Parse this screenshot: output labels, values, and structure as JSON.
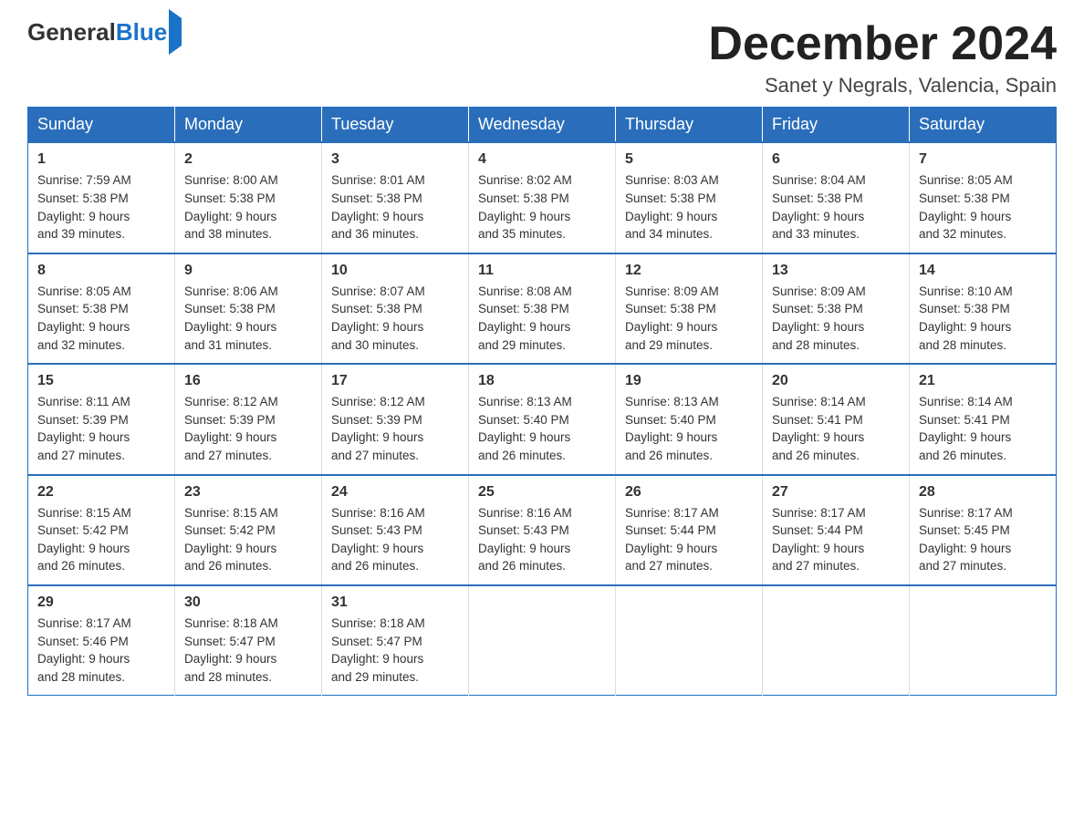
{
  "header": {
    "logo_general": "General",
    "logo_blue": "Blue",
    "month_title": "December 2024",
    "subtitle": "Sanet y Negrals, Valencia, Spain"
  },
  "weekdays": [
    "Sunday",
    "Monday",
    "Tuesday",
    "Wednesday",
    "Thursday",
    "Friday",
    "Saturday"
  ],
  "weeks": [
    [
      {
        "day": "1",
        "sunrise": "7:59 AM",
        "sunset": "5:38 PM",
        "daylight": "9 hours and 39 minutes."
      },
      {
        "day": "2",
        "sunrise": "8:00 AM",
        "sunset": "5:38 PM",
        "daylight": "9 hours and 38 minutes."
      },
      {
        "day": "3",
        "sunrise": "8:01 AM",
        "sunset": "5:38 PM",
        "daylight": "9 hours and 36 minutes."
      },
      {
        "day": "4",
        "sunrise": "8:02 AM",
        "sunset": "5:38 PM",
        "daylight": "9 hours and 35 minutes."
      },
      {
        "day": "5",
        "sunrise": "8:03 AM",
        "sunset": "5:38 PM",
        "daylight": "9 hours and 34 minutes."
      },
      {
        "day": "6",
        "sunrise": "8:04 AM",
        "sunset": "5:38 PM",
        "daylight": "9 hours and 33 minutes."
      },
      {
        "day": "7",
        "sunrise": "8:05 AM",
        "sunset": "5:38 PM",
        "daylight": "9 hours and 32 minutes."
      }
    ],
    [
      {
        "day": "8",
        "sunrise": "8:05 AM",
        "sunset": "5:38 PM",
        "daylight": "9 hours and 32 minutes."
      },
      {
        "day": "9",
        "sunrise": "8:06 AM",
        "sunset": "5:38 PM",
        "daylight": "9 hours and 31 minutes."
      },
      {
        "day": "10",
        "sunrise": "8:07 AM",
        "sunset": "5:38 PM",
        "daylight": "9 hours and 30 minutes."
      },
      {
        "day": "11",
        "sunrise": "8:08 AM",
        "sunset": "5:38 PM",
        "daylight": "9 hours and 29 minutes."
      },
      {
        "day": "12",
        "sunrise": "8:09 AM",
        "sunset": "5:38 PM",
        "daylight": "9 hours and 29 minutes."
      },
      {
        "day": "13",
        "sunrise": "8:09 AM",
        "sunset": "5:38 PM",
        "daylight": "9 hours and 28 minutes."
      },
      {
        "day": "14",
        "sunrise": "8:10 AM",
        "sunset": "5:38 PM",
        "daylight": "9 hours and 28 minutes."
      }
    ],
    [
      {
        "day": "15",
        "sunrise": "8:11 AM",
        "sunset": "5:39 PM",
        "daylight": "9 hours and 27 minutes."
      },
      {
        "day": "16",
        "sunrise": "8:12 AM",
        "sunset": "5:39 PM",
        "daylight": "9 hours and 27 minutes."
      },
      {
        "day": "17",
        "sunrise": "8:12 AM",
        "sunset": "5:39 PM",
        "daylight": "9 hours and 27 minutes."
      },
      {
        "day": "18",
        "sunrise": "8:13 AM",
        "sunset": "5:40 PM",
        "daylight": "9 hours and 26 minutes."
      },
      {
        "day": "19",
        "sunrise": "8:13 AM",
        "sunset": "5:40 PM",
        "daylight": "9 hours and 26 minutes."
      },
      {
        "day": "20",
        "sunrise": "8:14 AM",
        "sunset": "5:41 PM",
        "daylight": "9 hours and 26 minutes."
      },
      {
        "day": "21",
        "sunrise": "8:14 AM",
        "sunset": "5:41 PM",
        "daylight": "9 hours and 26 minutes."
      }
    ],
    [
      {
        "day": "22",
        "sunrise": "8:15 AM",
        "sunset": "5:42 PM",
        "daylight": "9 hours and 26 minutes."
      },
      {
        "day": "23",
        "sunrise": "8:15 AM",
        "sunset": "5:42 PM",
        "daylight": "9 hours and 26 minutes."
      },
      {
        "day": "24",
        "sunrise": "8:16 AM",
        "sunset": "5:43 PM",
        "daylight": "9 hours and 26 minutes."
      },
      {
        "day": "25",
        "sunrise": "8:16 AM",
        "sunset": "5:43 PM",
        "daylight": "9 hours and 26 minutes."
      },
      {
        "day": "26",
        "sunrise": "8:17 AM",
        "sunset": "5:44 PM",
        "daylight": "9 hours and 27 minutes."
      },
      {
        "day": "27",
        "sunrise": "8:17 AM",
        "sunset": "5:44 PM",
        "daylight": "9 hours and 27 minutes."
      },
      {
        "day": "28",
        "sunrise": "8:17 AM",
        "sunset": "5:45 PM",
        "daylight": "9 hours and 27 minutes."
      }
    ],
    [
      {
        "day": "29",
        "sunrise": "8:17 AM",
        "sunset": "5:46 PM",
        "daylight": "9 hours and 28 minutes."
      },
      {
        "day": "30",
        "sunrise": "8:18 AM",
        "sunset": "5:47 PM",
        "daylight": "9 hours and 28 minutes."
      },
      {
        "day": "31",
        "sunrise": "8:18 AM",
        "sunset": "5:47 PM",
        "daylight": "9 hours and 29 minutes."
      },
      null,
      null,
      null,
      null
    ]
  ],
  "labels": {
    "sunrise": "Sunrise:",
    "sunset": "Sunset:",
    "daylight": "Daylight:"
  }
}
